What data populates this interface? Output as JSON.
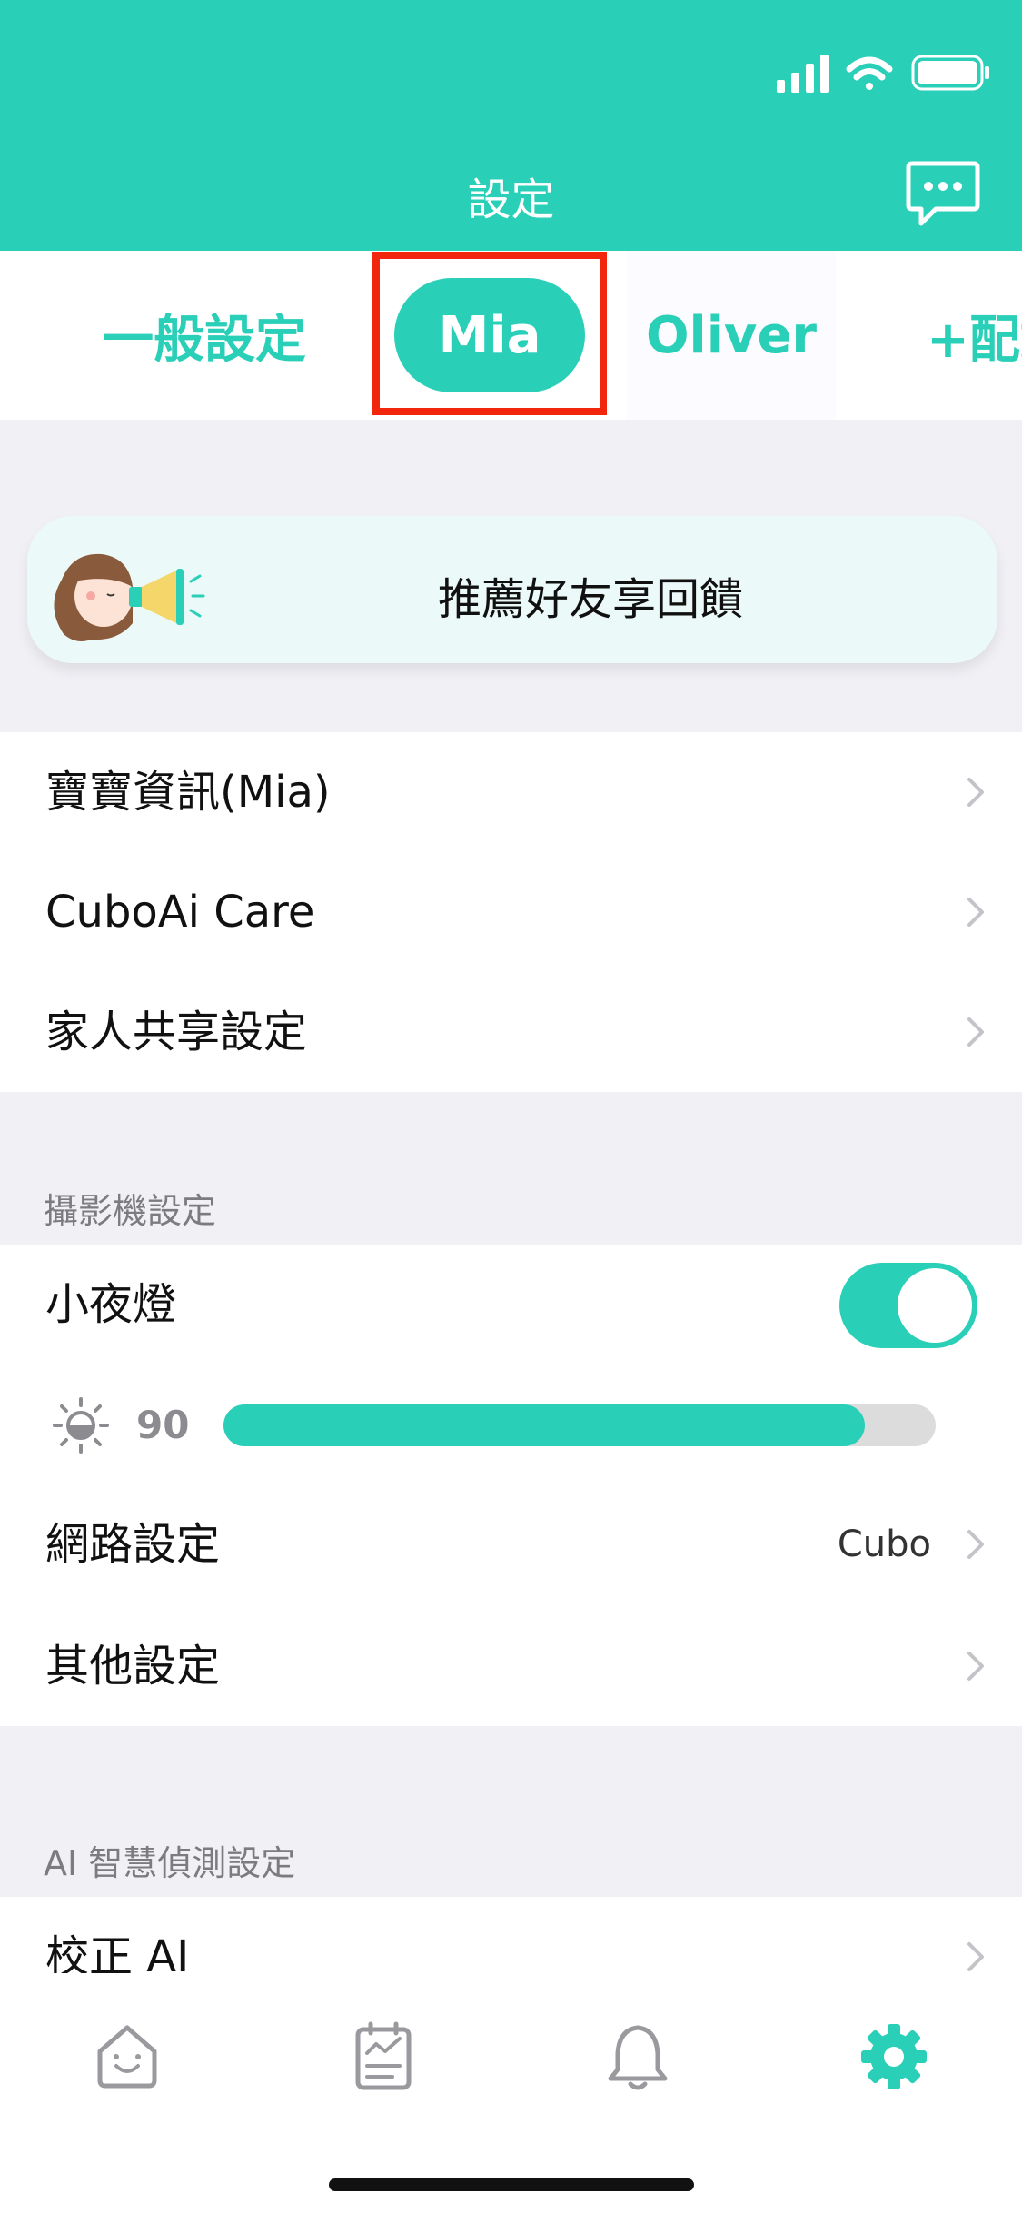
{
  "header": {
    "title": "設定",
    "chat_icon": "chat-bubble-dots-icon",
    "status_icons": [
      "signal-icon",
      "wifi-icon",
      "battery-icon"
    ]
  },
  "tabs": {
    "items": [
      {
        "label": "一般設定",
        "active": false
      },
      {
        "label": "Mia",
        "active": true
      },
      {
        "label": "Oliver",
        "active": false
      },
      {
        "label": "+配對",
        "active": false
      }
    ]
  },
  "banner": {
    "text": "推薦好友享回饋",
    "illustration": "girl-megaphone-illustration"
  },
  "baby_group": {
    "items": [
      {
        "label": "寶寶資訊(Mia)"
      },
      {
        "label": "CuboAi Care"
      },
      {
        "label": "家人共享設定"
      }
    ]
  },
  "camera_section": {
    "header": "攝影機設定",
    "night_light": {
      "label": "小夜燈",
      "on": true
    },
    "brightness": {
      "value": "90",
      "fraction": 0.9,
      "icon": "brightness-icon"
    },
    "network": {
      "label": "網路設定",
      "value": "Cubo"
    },
    "other": {
      "label": "其他設定"
    }
  },
  "ai_section": {
    "header": "AI 智慧偵測設定",
    "calibrate": {
      "label": "校正 AI"
    }
  },
  "tabbar": {
    "items": [
      {
        "icon": "home-icon",
        "active": false
      },
      {
        "icon": "journal-icon",
        "active": false
      },
      {
        "icon": "bell-icon",
        "active": false
      },
      {
        "icon": "gear-icon",
        "active": true
      }
    ]
  },
  "colors": {
    "accent": "#2acfb8",
    "highlight": "#f2260c",
    "background": "#f1f0f5"
  }
}
